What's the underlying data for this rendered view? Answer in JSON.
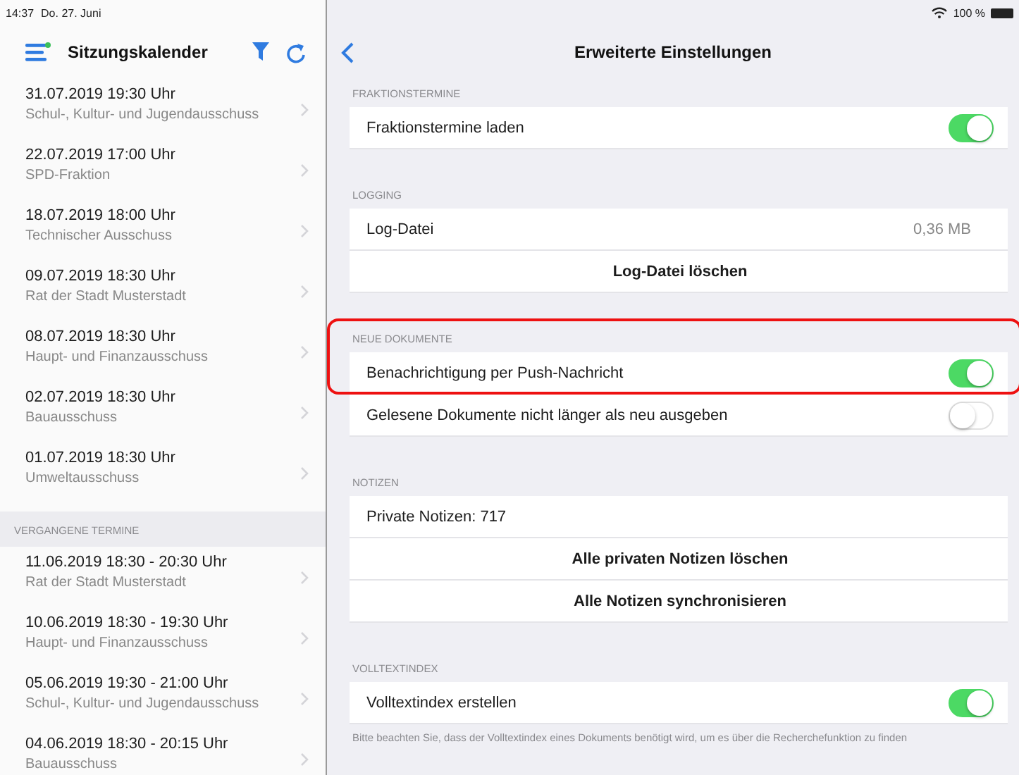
{
  "status_bar": {
    "time": "14:37",
    "date": "Do. 27. Juni",
    "battery": "100 %"
  },
  "sidebar": {
    "title": "Sitzungskalender",
    "groups": [
      {
        "items": [
          {
            "date": "31.07.2019 19:30 Uhr",
            "name": "Schul-, Kultur- und Jugendausschuss"
          },
          {
            "date": "22.07.2019 17:00 Uhr",
            "name": "SPD-Fraktion"
          },
          {
            "date": "18.07.2019 18:00 Uhr",
            "name": "Technischer Ausschuss"
          },
          {
            "date": "09.07.2019 18:30 Uhr",
            "name": "Rat der Stadt Musterstadt"
          },
          {
            "date": "08.07.2019 18:30 Uhr",
            "name": "Haupt- und Finanzausschuss"
          },
          {
            "date": "02.07.2019 18:30 Uhr",
            "name": "Bauausschuss"
          },
          {
            "date": "01.07.2019 18:30 Uhr",
            "name": "Umweltausschuss"
          }
        ]
      },
      {
        "header": "VERGANGENE TERMINE",
        "items": [
          {
            "date": "11.06.2019 18:30 -  20:30 Uhr",
            "name": "Rat der Stadt Musterstadt"
          },
          {
            "date": "10.06.2019 18:30 -  19:30 Uhr",
            "name": "Haupt- und Finanzausschuss"
          },
          {
            "date": "05.06.2019 19:30 -  21:00 Uhr",
            "name": "Schul-, Kultur- und Jugendausschuss"
          },
          {
            "date": "04.06.2019 18:30 -  20:15 Uhr",
            "name": "Bauausschuss"
          }
        ]
      }
    ]
  },
  "detail": {
    "title": "Erweiterte Einstellungen",
    "sections": [
      {
        "header": "FRAKTIONSTERMINE",
        "highlighted": false,
        "rows": [
          {
            "kind": "toggle",
            "label": "Fraktionstermine laden",
            "on": true
          }
        ]
      },
      {
        "header": "LOGGING",
        "highlighted": false,
        "rows": [
          {
            "kind": "value",
            "label": "Log-Datei",
            "value": "0,36 MB"
          },
          {
            "kind": "action",
            "label": "Log-Datei löschen"
          }
        ]
      },
      {
        "header": "NEUE DOKUMENTE",
        "highlighted": true,
        "rows": [
          {
            "kind": "toggle",
            "label": "Benachrichtigung per Push-Nachricht",
            "on": true
          },
          {
            "kind": "toggle",
            "label": "Gelesene Dokumente nicht länger als neu ausgeben",
            "on": false
          }
        ]
      },
      {
        "header": "NOTIZEN",
        "highlighted": false,
        "rows": [
          {
            "kind": "text",
            "label": "Private Notizen: 717"
          },
          {
            "kind": "action",
            "label": "Alle privaten Notizen löschen"
          },
          {
            "kind": "action",
            "label": "Alle Notizen synchronisieren"
          }
        ]
      },
      {
        "header": "VOLLTEXTINDEX",
        "highlighted": false,
        "rows": [
          {
            "kind": "toggle",
            "label": "Volltextindex erstellen",
            "on": true
          }
        ],
        "footer": "Bitte beachten Sie, dass der Volltextindex eines Dokuments benötigt wird, um es über die Recherchefunktion zu finden"
      }
    ]
  }
}
